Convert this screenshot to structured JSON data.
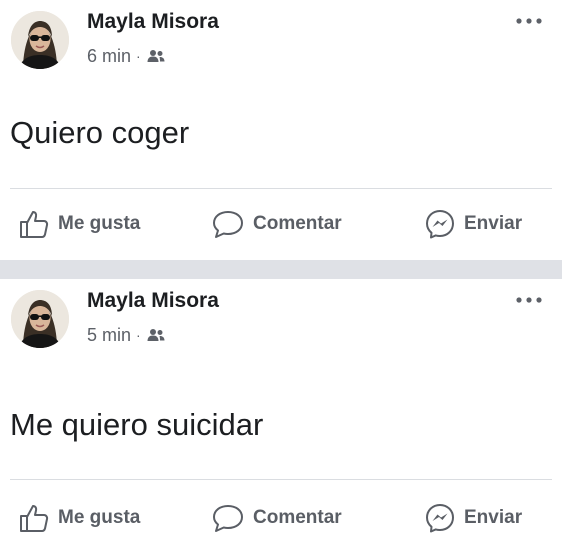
{
  "posts": [
    {
      "author": "Mayla Misora",
      "time": "6 min",
      "separator": "·",
      "audience_icon": "friends-icon",
      "menu_icon": "more-options-icon",
      "text": "Quiero coger",
      "actions": {
        "like": "Me gusta",
        "comment": "Comentar",
        "send": "Enviar"
      }
    },
    {
      "author": "Mayla Misora",
      "time": "5 min",
      "separator": "·",
      "audience_icon": "friends-icon",
      "menu_icon": "more-options-icon",
      "text": "Me quiero suicidar",
      "actions": {
        "like": "Me gusta",
        "comment": "Comentar",
        "send": "Enviar"
      }
    }
  ],
  "icons": {
    "like": "thumbs-up-icon",
    "comment": "comment-bubble-icon",
    "send": "messenger-icon"
  },
  "colors": {
    "text_primary": "#1c1e21",
    "text_secondary": "#5d6168",
    "action_text": "#5a5e65",
    "divider": "#dadde1",
    "feed_separator": "#dfe1e6"
  }
}
